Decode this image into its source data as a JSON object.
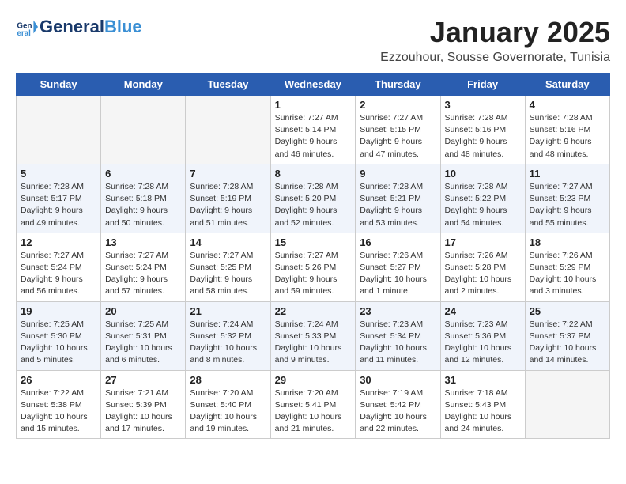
{
  "header": {
    "logo_general": "General",
    "logo_blue": "Blue",
    "month_title": "January 2025",
    "location": "Ezzouhour, Sousse Governorate, Tunisia"
  },
  "days_of_week": [
    "Sunday",
    "Monday",
    "Tuesday",
    "Wednesday",
    "Thursday",
    "Friday",
    "Saturday"
  ],
  "weeks": [
    [
      {
        "day": "",
        "info": ""
      },
      {
        "day": "",
        "info": ""
      },
      {
        "day": "",
        "info": ""
      },
      {
        "day": "1",
        "info": "Sunrise: 7:27 AM\nSunset: 5:14 PM\nDaylight: 9 hours and 46 minutes."
      },
      {
        "day": "2",
        "info": "Sunrise: 7:27 AM\nSunset: 5:15 PM\nDaylight: 9 hours and 47 minutes."
      },
      {
        "day": "3",
        "info": "Sunrise: 7:28 AM\nSunset: 5:16 PM\nDaylight: 9 hours and 48 minutes."
      },
      {
        "day": "4",
        "info": "Sunrise: 7:28 AM\nSunset: 5:16 PM\nDaylight: 9 hours and 48 minutes."
      }
    ],
    [
      {
        "day": "5",
        "info": "Sunrise: 7:28 AM\nSunset: 5:17 PM\nDaylight: 9 hours and 49 minutes."
      },
      {
        "day": "6",
        "info": "Sunrise: 7:28 AM\nSunset: 5:18 PM\nDaylight: 9 hours and 50 minutes."
      },
      {
        "day": "7",
        "info": "Sunrise: 7:28 AM\nSunset: 5:19 PM\nDaylight: 9 hours and 51 minutes."
      },
      {
        "day": "8",
        "info": "Sunrise: 7:28 AM\nSunset: 5:20 PM\nDaylight: 9 hours and 52 minutes."
      },
      {
        "day": "9",
        "info": "Sunrise: 7:28 AM\nSunset: 5:21 PM\nDaylight: 9 hours and 53 minutes."
      },
      {
        "day": "10",
        "info": "Sunrise: 7:28 AM\nSunset: 5:22 PM\nDaylight: 9 hours and 54 minutes."
      },
      {
        "day": "11",
        "info": "Sunrise: 7:27 AM\nSunset: 5:23 PM\nDaylight: 9 hours and 55 minutes."
      }
    ],
    [
      {
        "day": "12",
        "info": "Sunrise: 7:27 AM\nSunset: 5:24 PM\nDaylight: 9 hours and 56 minutes."
      },
      {
        "day": "13",
        "info": "Sunrise: 7:27 AM\nSunset: 5:24 PM\nDaylight: 9 hours and 57 minutes."
      },
      {
        "day": "14",
        "info": "Sunrise: 7:27 AM\nSunset: 5:25 PM\nDaylight: 9 hours and 58 minutes."
      },
      {
        "day": "15",
        "info": "Sunrise: 7:27 AM\nSunset: 5:26 PM\nDaylight: 9 hours and 59 minutes."
      },
      {
        "day": "16",
        "info": "Sunrise: 7:26 AM\nSunset: 5:27 PM\nDaylight: 10 hours and 1 minute."
      },
      {
        "day": "17",
        "info": "Sunrise: 7:26 AM\nSunset: 5:28 PM\nDaylight: 10 hours and 2 minutes."
      },
      {
        "day": "18",
        "info": "Sunrise: 7:26 AM\nSunset: 5:29 PM\nDaylight: 10 hours and 3 minutes."
      }
    ],
    [
      {
        "day": "19",
        "info": "Sunrise: 7:25 AM\nSunset: 5:30 PM\nDaylight: 10 hours and 5 minutes."
      },
      {
        "day": "20",
        "info": "Sunrise: 7:25 AM\nSunset: 5:31 PM\nDaylight: 10 hours and 6 minutes."
      },
      {
        "day": "21",
        "info": "Sunrise: 7:24 AM\nSunset: 5:32 PM\nDaylight: 10 hours and 8 minutes."
      },
      {
        "day": "22",
        "info": "Sunrise: 7:24 AM\nSunset: 5:33 PM\nDaylight: 10 hours and 9 minutes."
      },
      {
        "day": "23",
        "info": "Sunrise: 7:23 AM\nSunset: 5:34 PM\nDaylight: 10 hours and 11 minutes."
      },
      {
        "day": "24",
        "info": "Sunrise: 7:23 AM\nSunset: 5:36 PM\nDaylight: 10 hours and 12 minutes."
      },
      {
        "day": "25",
        "info": "Sunrise: 7:22 AM\nSunset: 5:37 PM\nDaylight: 10 hours and 14 minutes."
      }
    ],
    [
      {
        "day": "26",
        "info": "Sunrise: 7:22 AM\nSunset: 5:38 PM\nDaylight: 10 hours and 15 minutes."
      },
      {
        "day": "27",
        "info": "Sunrise: 7:21 AM\nSunset: 5:39 PM\nDaylight: 10 hours and 17 minutes."
      },
      {
        "day": "28",
        "info": "Sunrise: 7:20 AM\nSunset: 5:40 PM\nDaylight: 10 hours and 19 minutes."
      },
      {
        "day": "29",
        "info": "Sunrise: 7:20 AM\nSunset: 5:41 PM\nDaylight: 10 hours and 21 minutes."
      },
      {
        "day": "30",
        "info": "Sunrise: 7:19 AM\nSunset: 5:42 PM\nDaylight: 10 hours and 22 minutes."
      },
      {
        "day": "31",
        "info": "Sunrise: 7:18 AM\nSunset: 5:43 PM\nDaylight: 10 hours and 24 minutes."
      },
      {
        "day": "",
        "info": ""
      }
    ]
  ]
}
